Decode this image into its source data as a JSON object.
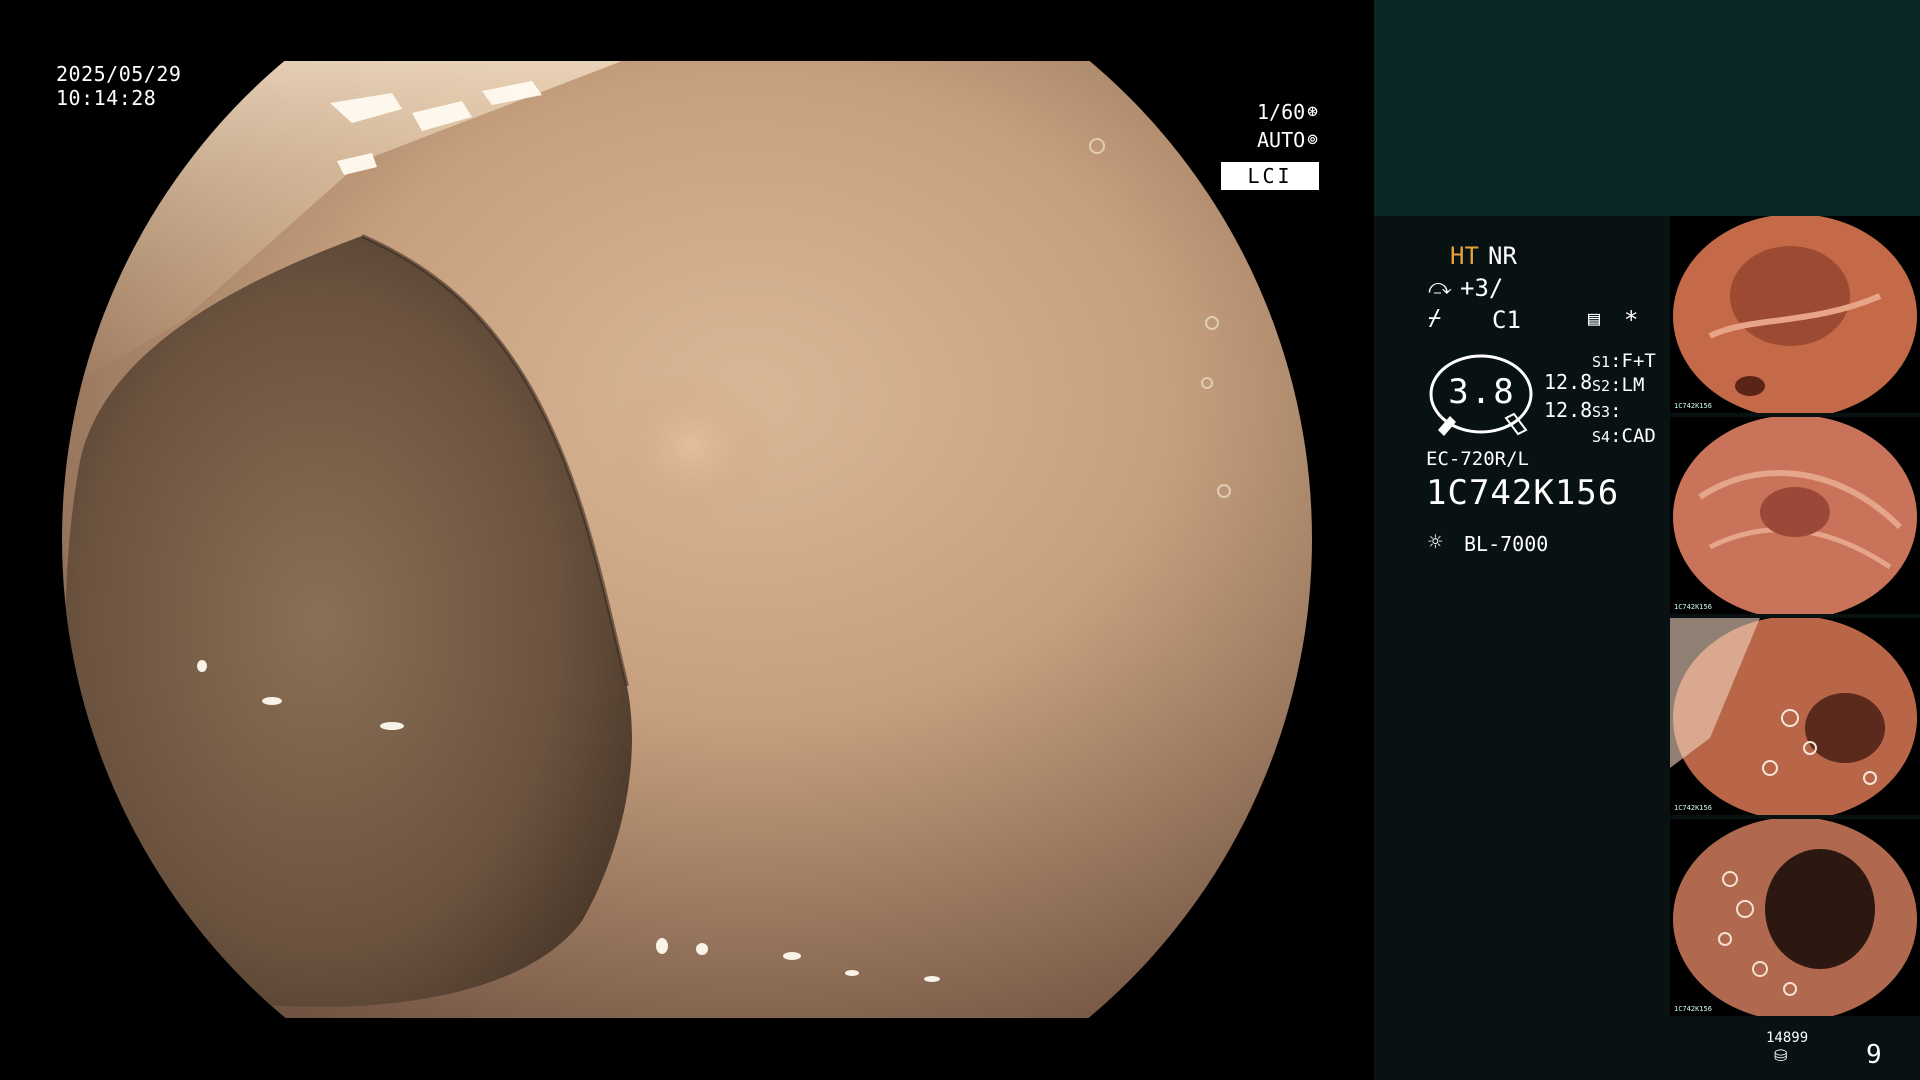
{
  "osd": {
    "date": "2025/05/29",
    "time": "10:14:28",
    "shutter": "1/60",
    "iris": "AUTO",
    "mode": "LCI"
  },
  "panel": {
    "ht": "HT",
    "nr": "NR",
    "enhance": "+3/",
    "color": "C1",
    "star": "*",
    "zoom_value": "3.8",
    "r1": "12.8",
    "r2": "12.8",
    "s1_label": "S1",
    "s1_value": "F+T",
    "s2_label": "S2",
    "s2_value": "LM",
    "s3_label": "S3",
    "s3_value": "",
    "s4_label": "S4",
    "s4_value": "CAD",
    "model": "EC-720R/L",
    "serial": "1C742K156",
    "light_source": "BL-7000"
  },
  "thumbnails": [
    {
      "tag": "1C742K156"
    },
    {
      "tag": "1C742K156"
    },
    {
      "tag": "1C742K156"
    },
    {
      "tag": "1C742K156"
    }
  ],
  "storage": {
    "remaining": "14899",
    "count": "9"
  },
  "icons": {
    "shutter": "aperture-icon",
    "iris": "iris-icon",
    "enhance": "structure-enhance-icon",
    "color": "color-mode-icon",
    "memo": "memo-icon",
    "light": "light-source-icon",
    "storage": "storage-disk-icon"
  }
}
